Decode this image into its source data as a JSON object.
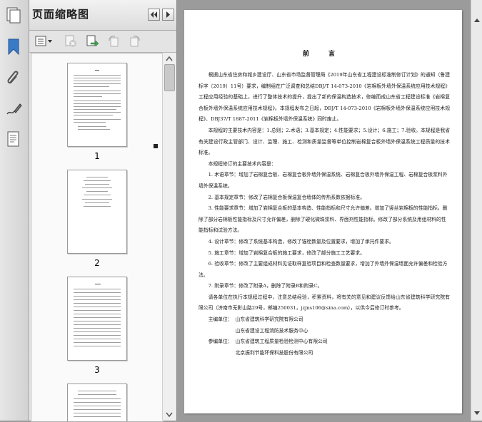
{
  "panel": {
    "title": "页面缩略图"
  },
  "thumbnails": [
    {
      "label": "1"
    },
    {
      "label": "2"
    },
    {
      "label": "3"
    }
  ],
  "document": {
    "title": "前  言",
    "para1": "根据山东省住房和城乡建设厅、山东省市场监督管理局《2019年山东省工程建设标准制修订计划》的通知（鲁建标字〔2019〕11号）要求，编制组在广泛调查和总结DBJ/T 14-073-2010《岩棉板外墙外保温系统应用技术规程》工程应用经验的基础上，进行了整体技术的提升，提出了新的保温构造技术，修编而成山东省工程建设标准《岩棉复合板外墙外保温系统应用技术规程》。本规程发布之日起，DBJ/T 14-073-2010《岩棉板外墙外保温系统应用技术规程》、DBJ37/T 1887-2011《岩棉板外墙外保温系统》同时废止。",
    "para2": "本规程的主要技术内容是：1.总则；2.术语；3.基本规定；4.性能要求；5.设计；6.施工；7.验收。本规程是我省有关建设行政主管部门、设计、监理、施工、检测和质量监督等单位控制岩棉复合板外墙外保温系统工程质量的技术标准。",
    "para3": "本规程修订的主要技术内容是：",
    "items": [
      "1. 术语章节：增加了岩棉复合板、岩棉复合板外墙外保温系统、岩棉复合板外墙外保温工程、岩棉复合板浆料外墙外保温系统。",
      "2. 基本规定章节：修改了岩棉复合板保温复合墙体的传热系数依据标准。",
      "3. 性能要求章节：增加了岩棉复合板的基本构造、性能指标和尺寸允许偏差。增加了竖丝岩棉板的性能指标，删除了部分岩棉板性能指标及尺寸允许偏差，删除了硬化微珠浆料、界面剂性能指标。修改了部分系统及用组材料的性能指标和试验方法。",
      "4. 设计章节：修改了系统基本构造，修改了锚栓数量及位置要求，增加了承托件要求。",
      "5. 施工章节：增加了岩棉复合板的施工要求，修改了部分施工工艺要求。",
      "6. 验收章节：修改了主要组成材料见证取样复验项目和检查数量要求，增加了外墙外保温墙面允许偏差和检验方法。",
      "7. 附录章节：修改了附录A，删除了附录B和附录C。"
    ],
    "para4": "请各单位在执行本规程过程中，注意总结经验，积累资料，将有关的意见和建议反馈给山东省建筑科学研究院有限公司（济南市无影山路29号，邮编250031，jzjns106@sina.com），以供今后修订时参考。",
    "editor_label": "主编单位：",
    "editors": [
      "山东省建筑科学研究院有限公司",
      "山东省建设工程消防技术服务中心"
    ],
    "participant_label": "参编单位：",
    "participants": [
      "山东省建筑工程质量检验检测中心有限公司",
      "北京振利节能环保科技股份有限公司"
    ]
  }
}
